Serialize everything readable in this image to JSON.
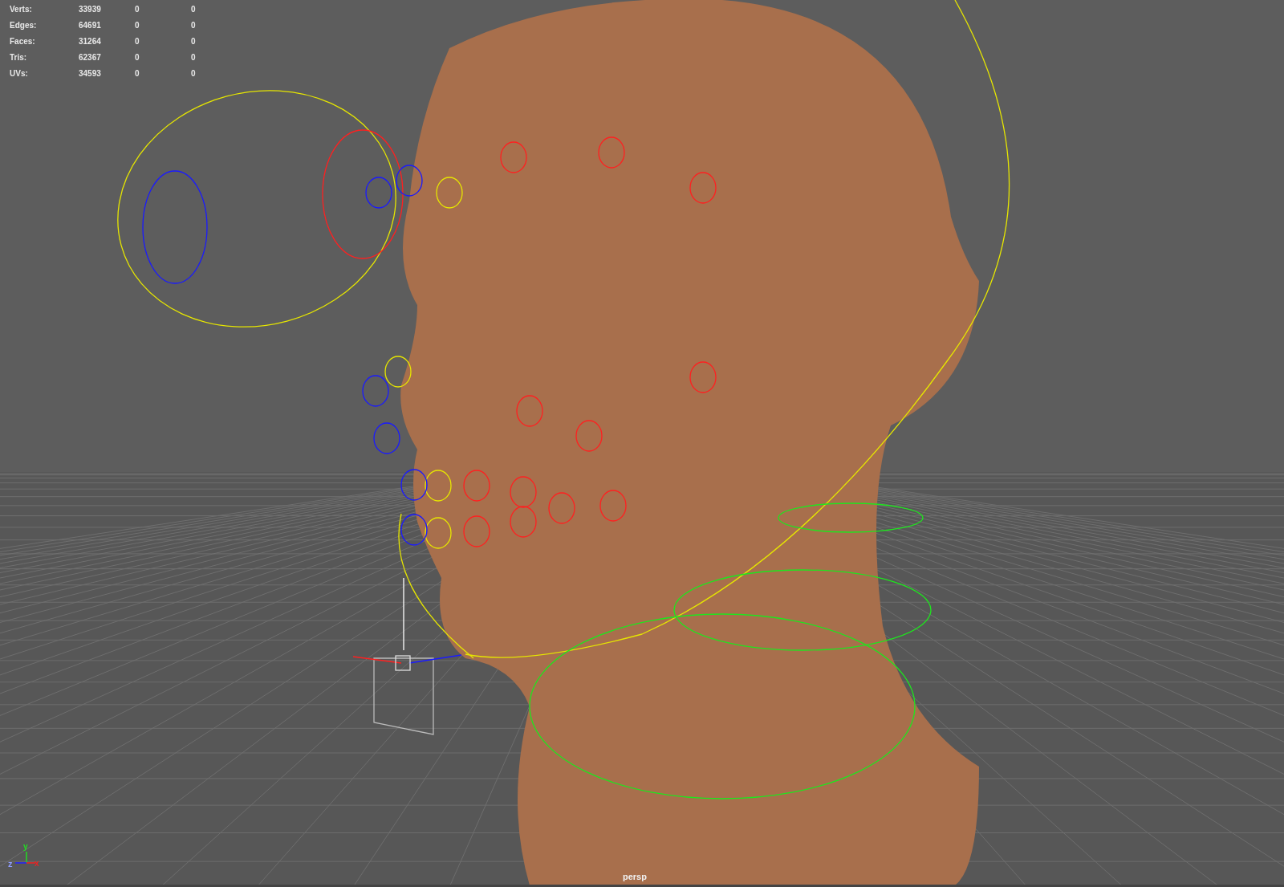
{
  "hud": {
    "rows": [
      {
        "label": "Verts:",
        "values": [
          "33939",
          "0",
          "0"
        ]
      },
      {
        "label": "Edges:",
        "values": [
          "64691",
          "0",
          "0"
        ]
      },
      {
        "label": "Faces:",
        "values": [
          "31264",
          "0",
          "0"
        ]
      },
      {
        "label": "Tris:",
        "values": [
          "62367",
          "0",
          "0"
        ]
      },
      {
        "label": "UVs:",
        "values": [
          "34593",
          "0",
          "0"
        ]
      }
    ]
  },
  "axes": {
    "x": "x",
    "y": "y",
    "z": "z"
  },
  "camera_label": "persp"
}
